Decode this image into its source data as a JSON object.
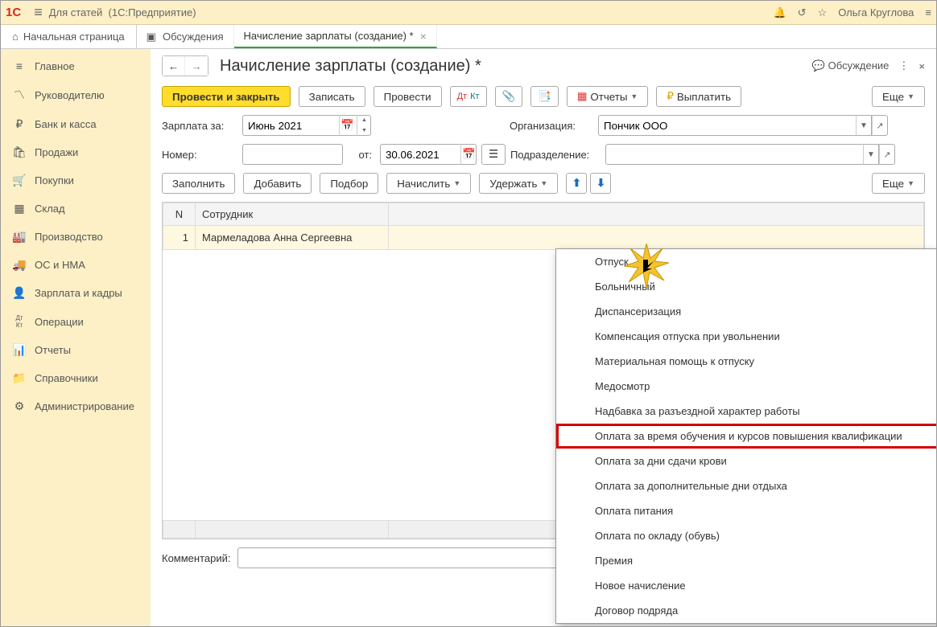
{
  "titlebar": {
    "app": "Для статей",
    "platform": "(1С:Предприятие)",
    "user": "Ольга Круглова"
  },
  "tabs": {
    "home": "Начальная страница",
    "discussions": "Обсуждения",
    "active": "Начисление зарплаты (создание) *"
  },
  "sidebar": {
    "items": [
      {
        "icon": "≡",
        "label": "Главное"
      },
      {
        "icon": "〽",
        "label": "Руководителю"
      },
      {
        "icon": "₽",
        "label": "Банк и касса"
      },
      {
        "icon": "🛍",
        "label": "Продажи"
      },
      {
        "icon": "🛒",
        "label": "Покупки"
      },
      {
        "icon": "▦",
        "label": "Склад"
      },
      {
        "icon": "🏭",
        "label": "Производство"
      },
      {
        "icon": "🚚",
        "label": "ОС и НМА"
      },
      {
        "icon": "👤",
        "label": "Зарплата и кадры"
      },
      {
        "icon": "Дт Кт",
        "label": "Операции"
      },
      {
        "icon": "📊",
        "label": "Отчеты"
      },
      {
        "icon": "📁",
        "label": "Справочники"
      },
      {
        "icon": "⚙",
        "label": "Администрирование"
      }
    ]
  },
  "page": {
    "title": "Начисление зарплаты (создание) *",
    "discussion": "Обсуждение"
  },
  "toolbar": {
    "post_close": "Провести и закрыть",
    "save": "Записать",
    "post": "Провести",
    "reports": "Отчеты",
    "pay": "Выплатить",
    "more": "Еще"
  },
  "form": {
    "salary_for_label": "Зарплата за:",
    "salary_for_value": "Июнь 2021",
    "org_label": "Организация:",
    "org_value": "Пончик ООО",
    "number_label": "Номер:",
    "number_value": "",
    "from_label": "от:",
    "date_value": "30.06.2021",
    "dept_label": "Подразделение:",
    "dept_value": ""
  },
  "toolbar2": {
    "fill": "Заполнить",
    "add": "Добавить",
    "select": "Подбор",
    "accrue": "Начислить",
    "withhold": "Удержать",
    "more": "Еще"
  },
  "table": {
    "col_n": "N",
    "col_employee": "Сотрудник",
    "rows": [
      {
        "n": "1",
        "employee": "Мармеладова Анна Сергеевна"
      }
    ]
  },
  "dropdown": {
    "items": [
      "Отпуск",
      "Больничный",
      "Диспансеризация",
      "Компенсация отпуска при увольнении",
      "Материальная помощь к отпуску",
      "Медосмотр",
      "Надбавка за разъездной характер работы",
      "Оплата за время обучения и курсов повышения квалификации",
      "Оплата за дни сдачи крови",
      "Оплата за дополнительные дни отдыха",
      "Оплата питания",
      "Оплата по окладу (обувь)",
      "Премия",
      "Новое начисление",
      "Договор подряда"
    ],
    "highlighted_index": 7
  },
  "comment": {
    "label": "Комментарий:",
    "value": ""
  }
}
